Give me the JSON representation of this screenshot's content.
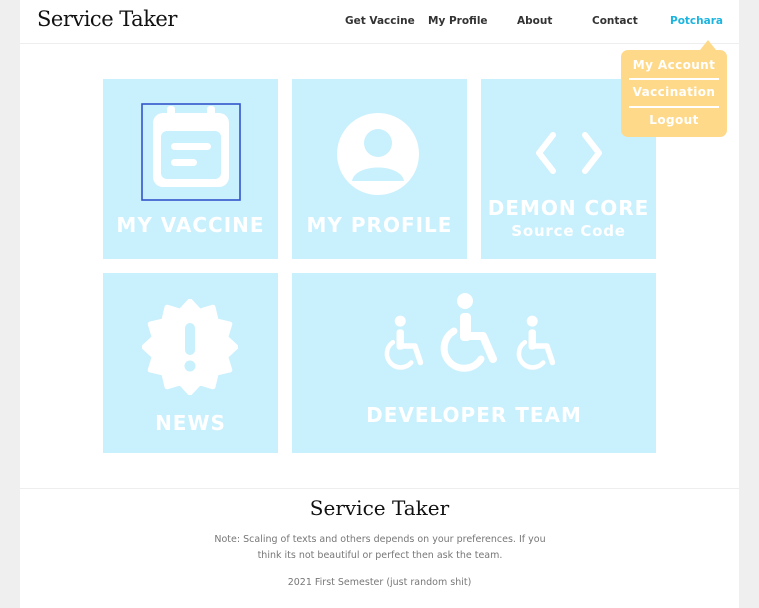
{
  "header": {
    "brand": "Service Taker",
    "nav": {
      "get_vaccine": "Get Vaccine",
      "my_profile": "My Profile",
      "about": "About",
      "contact": "Contact",
      "user": "Potchara"
    }
  },
  "user_menu": {
    "items": [
      "My Account",
      "Vaccination",
      "Logout"
    ],
    "color": "#ffd98a"
  },
  "tiles": {
    "my_vaccine": "MY VACCINE",
    "my_profile": "MY PROFILE",
    "demon_core": "DEMON CORE",
    "demon_core_sub": "Source Code",
    "news": "NEWS",
    "developer_team": "DEVELOPER TEAM",
    "icons": {
      "my_vaccine": "calendar-icon",
      "my_profile": "user-avatar-icon",
      "demon_core": "code-icon",
      "news": "exclamation-badge-icon",
      "developer_team": "wheelchair-icon"
    },
    "color": "#c9f0fd"
  },
  "footer": {
    "title": "Service Taker",
    "note": "Note: Scaling of texts and others depends on your preferences. If you think its not beautiful or perfect then ask the team.",
    "semester": "2021 First Semester (just random shit)"
  },
  "colors": {
    "accent": "#1cb5e0",
    "focus_outline": "#3355cc"
  }
}
